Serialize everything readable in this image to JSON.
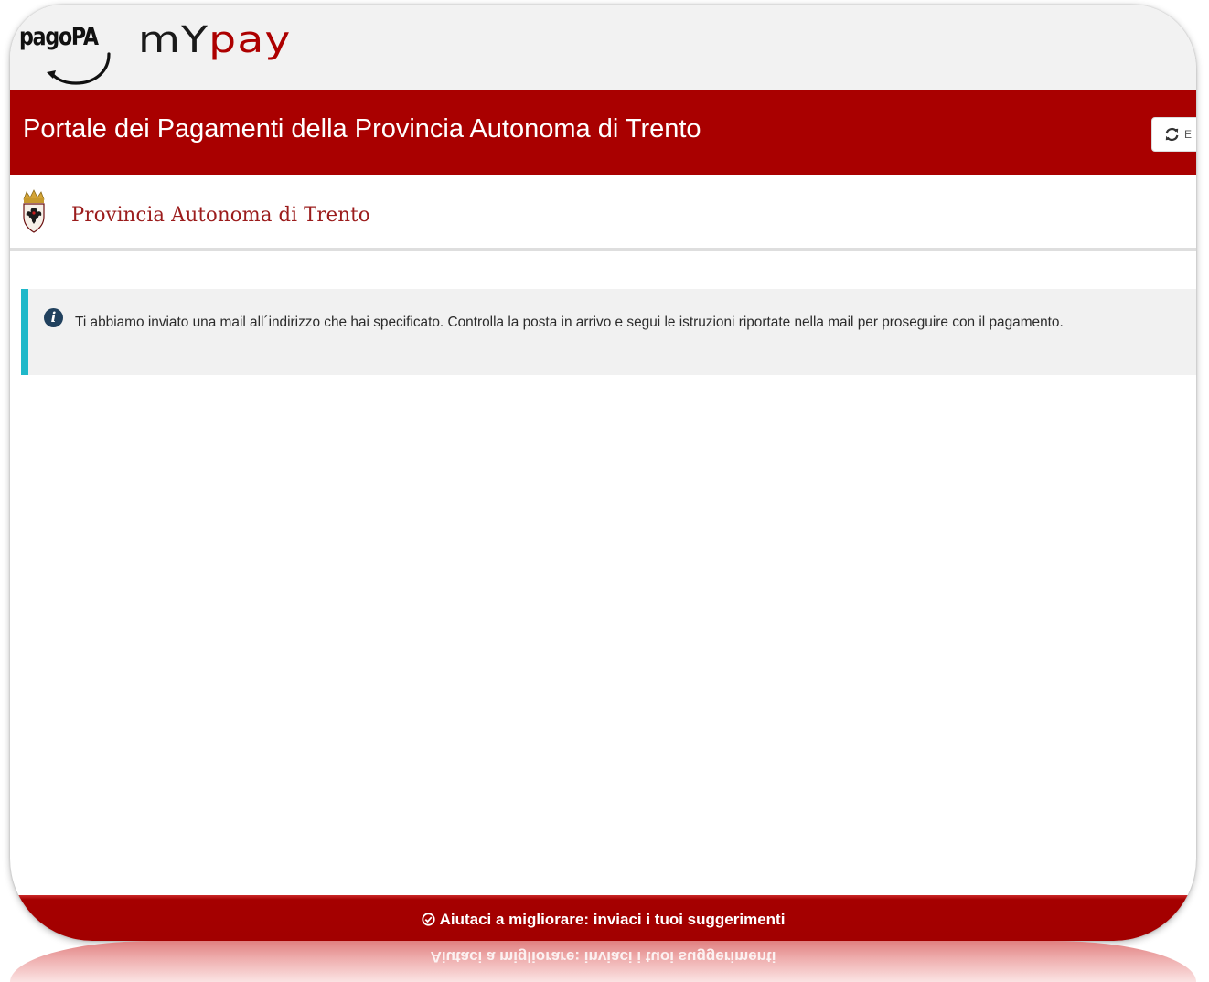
{
  "header": {
    "pagopa_logo_text": "pagoPA",
    "mypay_logo_my": "mY",
    "mypay_logo_pay": "pay"
  },
  "title_bar": {
    "title": "Portale dei Pagamenti della Provincia Autonoma di Trento",
    "refresh_button_label": "E",
    "refresh_icon": "refresh-icon",
    "background_color": "#a90000"
  },
  "entity": {
    "name": "Provincia Autonoma di Trento",
    "emblem_icon": "coat-of-arms-icon",
    "name_color": "#9b1c1c"
  },
  "alert": {
    "icon": "info-circle-icon",
    "message": "Ti abbiamo inviato una mail all´indirizzo che hai specificato. Controlla la posta in arrivo e segui le istruzioni riportate nella mail per proseguire con il pagamento.",
    "accent_color": "#1fb8c9"
  },
  "footer": {
    "icon": "check-circle-icon",
    "feedback_link": "Aiutaci a migliorare: inviaci i tuoi suggerimenti",
    "background_color": "#a20000"
  }
}
